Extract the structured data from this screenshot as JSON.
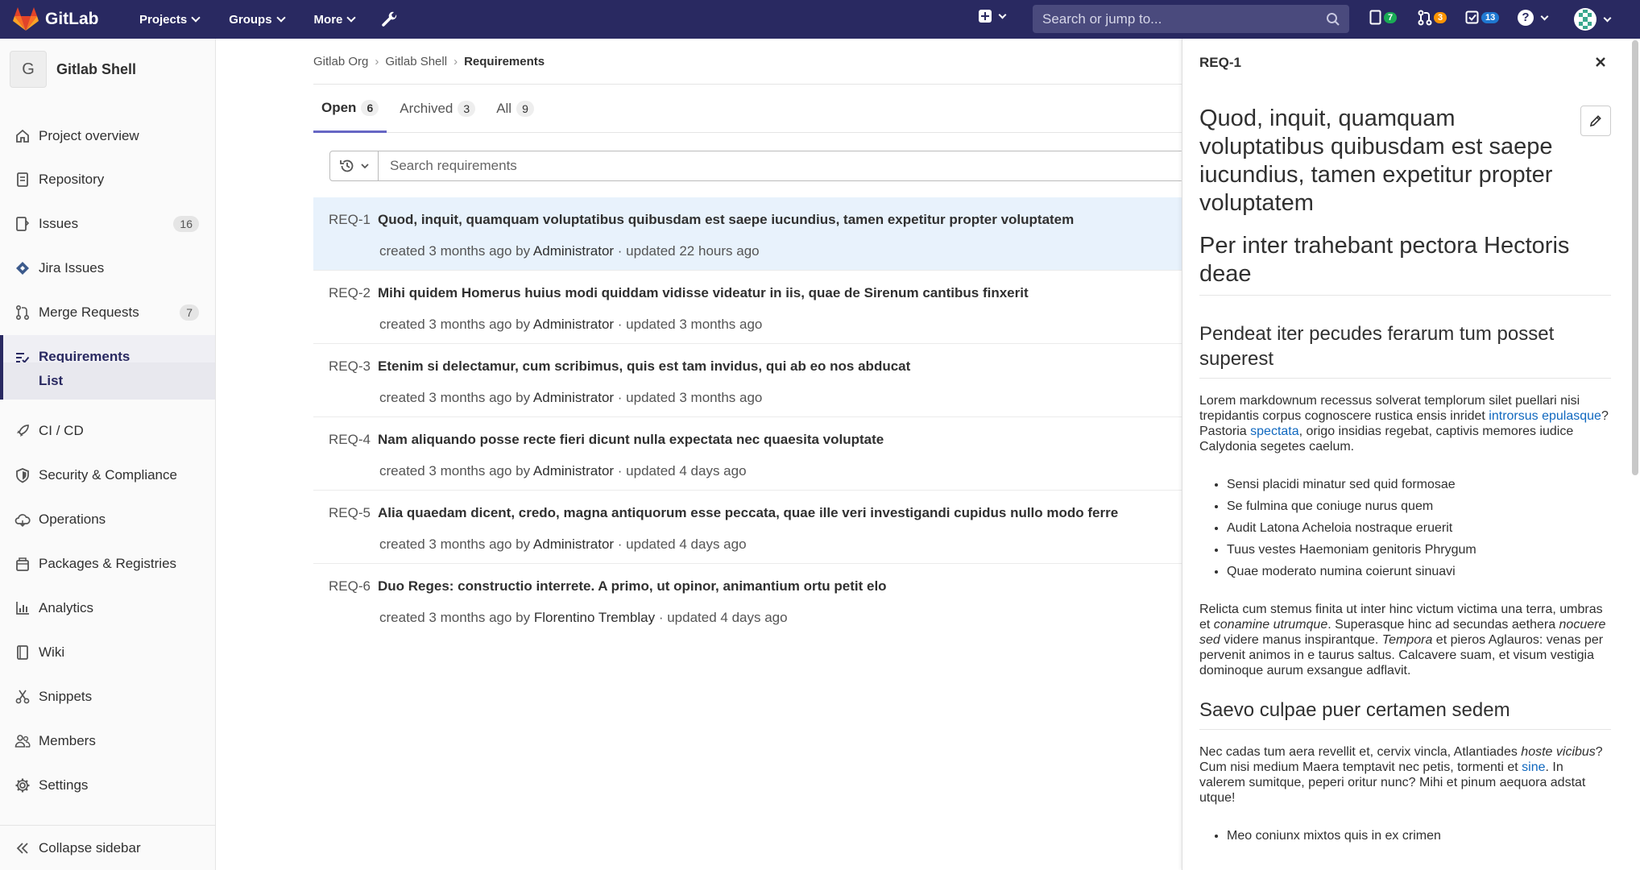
{
  "navbar": {
    "brand": "GitLab",
    "menus": [
      {
        "label": "Projects"
      },
      {
        "label": "Groups"
      },
      {
        "label": "More"
      }
    ],
    "search_placeholder": "Search or jump to...",
    "counters": {
      "issues": "7",
      "merge_requests": "3",
      "todos": "13"
    },
    "colors": {
      "navbar": "#292961",
      "issues_badge": "#1aaa55",
      "mr_badge": "#fc9403",
      "todos_badge": "#1f78d1"
    }
  },
  "sidebar": {
    "project_letter": "G",
    "project_name": "Gitlab Shell",
    "items": [
      {
        "label": "Project overview",
        "icon": "home-icon"
      },
      {
        "label": "Repository",
        "icon": "doc-icon"
      },
      {
        "label": "Issues",
        "icon": "issues-icon",
        "count": "16"
      },
      {
        "label": "Jira Issues",
        "icon": "jira-icon"
      },
      {
        "label": "Merge Requests",
        "icon": "merge-request-icon",
        "count": "7"
      },
      {
        "label": "Requirements",
        "icon": "requirements-icon"
      },
      {
        "label": "CI / CD",
        "icon": "rocket-icon"
      },
      {
        "label": "Security & Compliance",
        "icon": "shield-icon"
      },
      {
        "label": "Operations",
        "icon": "cloud-icon"
      },
      {
        "label": "Packages & Registries",
        "icon": "package-icon"
      },
      {
        "label": "Analytics",
        "icon": "chart-icon"
      },
      {
        "label": "Wiki",
        "icon": "book-icon"
      },
      {
        "label": "Snippets",
        "icon": "scissors-icon"
      },
      {
        "label": "Members",
        "icon": "users-icon"
      },
      {
        "label": "Settings",
        "icon": "gear-icon"
      }
    ],
    "sub_item": "List",
    "collapse": "Collapse sidebar"
  },
  "breadcrumb": {
    "items": [
      "Gitlab Org",
      "Gitlab Shell",
      "Requirements"
    ]
  },
  "tabs": [
    {
      "label": "Open",
      "count": "6"
    },
    {
      "label": "Archived",
      "count": "3"
    },
    {
      "label": "All",
      "count": "9"
    }
  ],
  "filter": {
    "placeholder": "Search requirements"
  },
  "requirements": [
    {
      "ref": "REQ-1",
      "title": "Quod, inquit, quamquam voluptatibus quibusdam est saepe iucundius, tamen expetitur propter voluptatem",
      "created": "created 3 months ago by",
      "author": "Administrator",
      "updated": "· updated 22 hours ago"
    },
    {
      "ref": "REQ-2",
      "title": "Mihi quidem Homerus huius modi quiddam vidisse videatur in iis, quae de Sirenum cantibus finxerit",
      "created": "created 3 months ago by",
      "author": "Administrator",
      "updated": "· updated 3 months ago"
    },
    {
      "ref": "REQ-3",
      "title": "Etenim si delectamur, cum scribimus, quis est tam invidus, qui ab eo nos abducat",
      "created": "created 3 months ago by",
      "author": "Administrator",
      "updated": "· updated 3 months ago"
    },
    {
      "ref": "REQ-4",
      "title": "Nam aliquando posse recte fieri dicunt nulla expectata nec quaesita voluptate",
      "created": "created 3 months ago by",
      "author": "Administrator",
      "updated": "· updated 4 days ago"
    },
    {
      "ref": "REQ-5",
      "title": "Alia quaedam dicent, credo, magna antiquorum esse peccata, quae ille veri investigandi cupidus nullo modo ferre",
      "created": "created 3 months ago by",
      "author": "Administrator",
      "updated": "· updated 4 days ago"
    },
    {
      "ref": "REQ-6",
      "title": "Duo Reges: constructio interrete. A primo, ut opinor, animantium ortu petit elo",
      "created": "created 3 months ago by",
      "author": "Florentino Tremblay",
      "updated": "· updated 4 days ago"
    }
  ],
  "drawer": {
    "ref": "REQ-1",
    "title": "Quod, inquit, quamquam voluptatibus quibusdam est saepe iucundius, tamen expetitur propter voluptatem",
    "h1": "Per inter trahebant pectora Hectoris deae",
    "h2a": "Pendeat iter pecudes ferarum tum posset superest",
    "p1": {
      "a": "Lorem markdownum recessus solverat templorum silet puellari nisi trepidantis corpus cognoscere rustica ensis inridet ",
      "link1": "introrsus epulasque",
      "b": "? Pastoria ",
      "link2": "spectata",
      "c": ", origo insidias regebat, captivis memores iudice Calydonia segetes caelum."
    },
    "list1": [
      "Sensi placidi minatur sed quid formosae",
      "Se fulmina que coniuge nurus quem",
      "Audit Latona Acheloia nostraque eruerit",
      "Tuus vestes Haemoniam genitoris Phrygum",
      "Quae moderato numina coierunt sinuavi"
    ],
    "p2": {
      "a": "Relicta cum stemus finita ut inter hinc victum victima una terra, umbras et ",
      "em1": "conamine utrumque",
      "b": ". Superasque hinc ad secundas aethera ",
      "em2": "nocuere sed",
      "c": " videre manus inspirantque. ",
      "em3": "Tempora",
      "d": " et pieros Aglauros: venas per pervenit animos in e taurus saltus. Calcavere suam, et visum vestigia dominoque aurum exsangue adflavit."
    },
    "h2b": "Saevo culpae puer certamen sedem",
    "p3": {
      "a": "Nec cadas tum aera revellit et, cervix vincla, Atlantiades ",
      "em1": "hoste vicibus",
      "b": "? Cum nisi medium Maera temptavit nec petis, tormenti et ",
      "link1": "sine",
      "c": ". In valerem sumitque, peperi oritur nunc? Mihi et pinum aequora adstat utque!"
    },
    "list2": [
      "Meo coniunx mixtos quis in ex crimen"
    ]
  }
}
